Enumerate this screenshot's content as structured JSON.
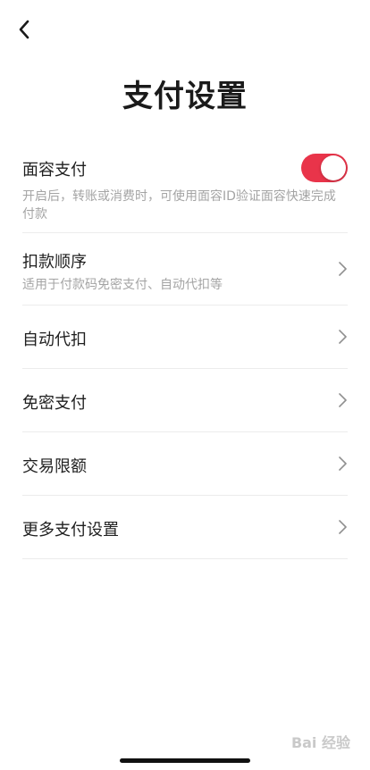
{
  "header": {
    "back_icon": "chevron-left-icon",
    "title": "支付设置"
  },
  "settings": {
    "face_pay": {
      "title": "面容支付",
      "description": "开启后，转账或消费时，可使用面容ID验证面容快速完成付款",
      "toggle_on": true,
      "toggle_color": "#e9344a"
    },
    "deduction_order": {
      "title": "扣款顺序",
      "description": "适用于付款码免密支付、自动代扣等"
    },
    "auto_deduct": {
      "title": "自动代扣"
    },
    "password_free": {
      "title": "免密支付"
    },
    "transaction_limit": {
      "title": "交易限额"
    },
    "more_settings": {
      "title": "更多支付设置"
    }
  },
  "watermark": {
    "text": "Bai 经验"
  }
}
